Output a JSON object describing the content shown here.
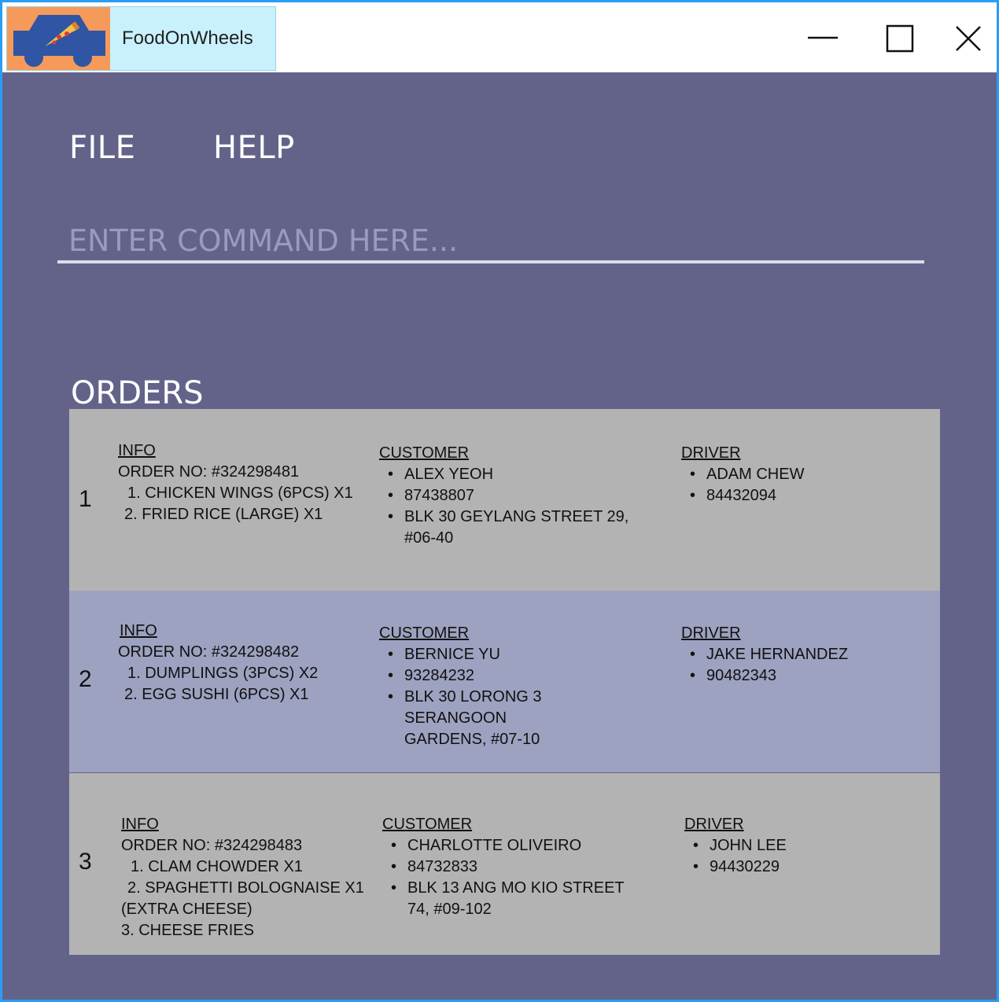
{
  "window": {
    "app_title": "FoodOnWheels"
  },
  "colors": {
    "background": "#63638a",
    "titlebar": "#ffffff",
    "app_tab": "#c9f1fd",
    "logo_bg": "#f59a5a",
    "logo_car": "#2f55a4",
    "row_gray": "#b3b3b3",
    "row_blue": "#9da2c0",
    "accent_border": "#2a9df4"
  },
  "icons": {
    "logo": "car-with-pizza-icon",
    "minimize": "minimize-icon",
    "maximize": "maximize-icon",
    "close": "close-icon"
  },
  "menu": {
    "file": "FILE",
    "help": "HELP"
  },
  "command": {
    "placeholder": "ENTER COMMAND HERE..."
  },
  "orders_heading": "ORDERS",
  "orders": [
    {
      "index": "1",
      "info_header": "INFO",
      "order_no": "ORDER NO: #324298481",
      "items": [
        "1. CHICKEN WINGS (6PCS) X1",
        "2. FRIED RICE (LARGE) X1"
      ],
      "customer_header": "CUSTOMER",
      "customer": [
        "ALEX YEOH",
        "87438807",
        "BLK 30 GEYLANG STREET 29,",
        "#06-40"
      ],
      "driver_header": "DRIVER",
      "driver": [
        "ADAM CHEW",
        "84432094"
      ]
    },
    {
      "index": "2",
      "info_header": "INFO",
      "order_no": "ORDER NO: #324298482",
      "items": [
        "1. DUMPLINGS (3PCS) X2",
        "2. EGG SUSHI (6PCS) X1"
      ],
      "customer_header": "CUSTOMER",
      "customer": [
        "BERNICE YU",
        "93284232",
        "BLK 30 LORONG 3 SERANGOON",
        "GARDENS, #07-10"
      ],
      "driver_header": "DRIVER",
      "driver": [
        "JAKE HERNANDEZ",
        "90482343"
      ]
    },
    {
      "index": "3",
      "info_header": "INFO",
      "order_no": "ORDER NO: #324298483",
      "items": [
        "1. CLAM CHOWDER X1",
        "2. SPAGHETTI BOLOGNAISE X1",
        "(EXTRA CHEESE)",
        "3. CHEESE FRIES"
      ],
      "customer_header": "CUSTOMER",
      "customer": [
        "CHARLOTTE OLIVEIRO",
        "84732833",
        "BLK 13 ANG MO KIO STREET",
        "74, #09-102"
      ],
      "driver_header": "DRIVER",
      "driver": [
        "JOHN LEE",
        "94430229"
      ]
    }
  ]
}
